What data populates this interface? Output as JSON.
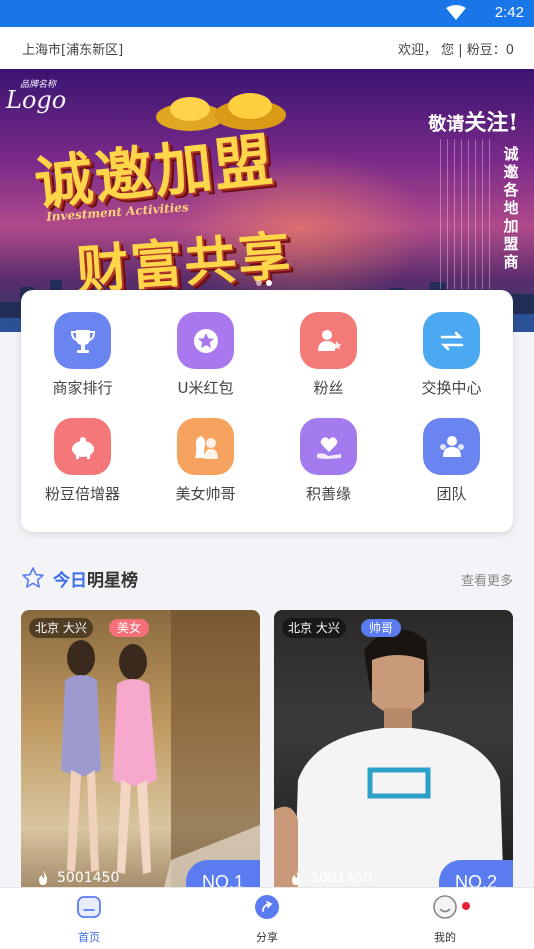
{
  "status_bar": {
    "time": "2:42"
  },
  "header": {
    "location": "上海市[浦东新区]",
    "welcome": "欢迎，  您 | 粉豆：0"
  },
  "banner": {
    "logo_small": "品牌名称",
    "logo_big": "Logo",
    "headline_1": "诚邀加盟",
    "subtitle": "Investment Activities",
    "headline_2": "财富共享",
    "follow_pre": "敬请",
    "follow": "关注!",
    "vertical_text": "诚邀各地加盟商",
    "slides": 2,
    "active_slide": 1
  },
  "menu": {
    "items": [
      {
        "label": "商家排行",
        "icon": "trophy-icon",
        "color": "#6a84f0"
      },
      {
        "label": "U米红包",
        "icon": "star-badge-icon",
        "color": "#a978ef"
      },
      {
        "label": "粉丝",
        "icon": "fans-icon",
        "color": "#f47a78"
      },
      {
        "label": "交换中心",
        "icon": "exchange-icon",
        "color": "#4aa9f0"
      },
      {
        "label": "粉豆倍增器",
        "icon": "piggy-bank-icon",
        "color": "#f4787a"
      },
      {
        "label": "美女帅哥",
        "icon": "couple-icon",
        "color": "#f7a360"
      },
      {
        "label": "积善缘",
        "icon": "heart-hand-icon",
        "color": "#a47aef"
      },
      {
        "label": "团队",
        "icon": "team-icon",
        "color": "#6a84f0"
      }
    ]
  },
  "stars": {
    "title_highlight": "今日",
    "title_rest": "明星榜",
    "more": "查看更多",
    "cards": [
      {
        "location": "北京 大兴",
        "tag": "美女",
        "tag_color": "#f5707a",
        "views": "5001450",
        "rank": "NO.1"
      },
      {
        "location": "北京 大兴",
        "tag": "帅哥",
        "tag_color": "#5b7cf0",
        "views": "5001450",
        "rank": "NO.2"
      }
    ]
  },
  "tabbar": {
    "items": [
      {
        "label": "首页",
        "icon": "home-icon",
        "active": true
      },
      {
        "label": "分享",
        "icon": "share-icon",
        "active": false
      },
      {
        "label": "我的",
        "icon": "profile-icon",
        "active": false,
        "badge": true
      }
    ]
  }
}
